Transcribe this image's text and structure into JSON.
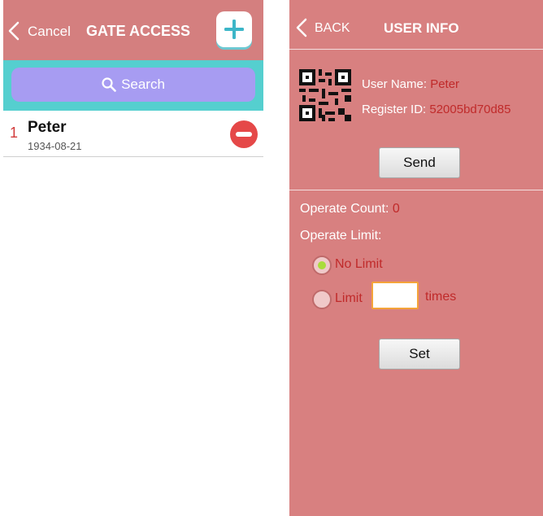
{
  "left_screen": {
    "header": {
      "cancel_label": "Cancel",
      "title": "GATE ACCESS",
      "add_icon": "plus-icon"
    },
    "search": {
      "label": "Search",
      "icon": "search-icon"
    },
    "users": [
      {
        "index": "1",
        "name": "Peter",
        "date": "1934-08-21"
      }
    ],
    "colors": {
      "header_bg": "#d47f7f",
      "search_bar_bg": "#55cfcf",
      "search_pill": "#a79cf2",
      "remove_button": "#e54848"
    }
  },
  "right_screen": {
    "header": {
      "back_label": "BACK",
      "title": "USER INFO"
    },
    "user_name_label": "User Name: ",
    "user_name_value": "Peter",
    "register_id_label": "Register ID: ",
    "register_id_value": "52005bd70d85",
    "send_label": "Send",
    "operate_count_label": "Operate Count: ",
    "operate_count_value": "0",
    "operate_limit_label": "Operate Limit:",
    "no_limit_label": "No Limit",
    "limit_label": "Limit",
    "limit_value": "",
    "times_label": "times",
    "selected_option": "No Limit",
    "set_label": "Set",
    "colors": {
      "background": "#d88080",
      "value_text": "#c02a2a",
      "input_border": "#f4a43a"
    }
  }
}
